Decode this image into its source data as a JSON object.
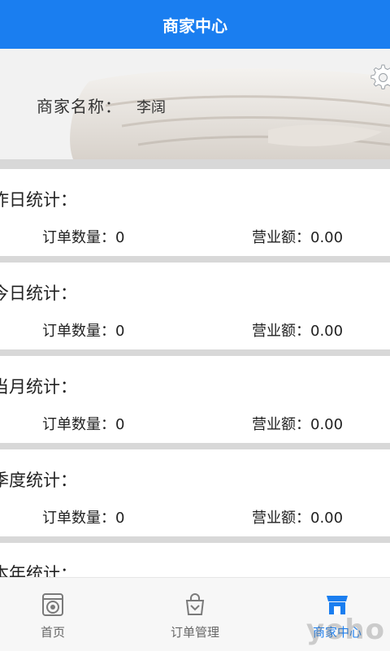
{
  "title": "商家中心",
  "merchant": {
    "label": "商家名称：",
    "name": "李阔"
  },
  "stats": [
    {
      "title": "昨日统计：",
      "orders_label": "订单数量：0",
      "revenue_label": "营业额：0.00"
    },
    {
      "title": "今日统计：",
      "orders_label": "订单数量：0",
      "revenue_label": "营业额：0.00"
    },
    {
      "title": "当月统计：",
      "orders_label": "订单数量：0",
      "revenue_label": "营业额：0.00"
    },
    {
      "title": "季度统计：",
      "orders_label": "订单数量：0",
      "revenue_label": "营业额：0.00"
    },
    {
      "title": "本年统计：",
      "orders_label": "",
      "revenue_label": ""
    }
  ],
  "tabs": [
    {
      "label": "首页",
      "icon": "washing-machine-icon"
    },
    {
      "label": "订单管理",
      "icon": "shopping-bag-icon"
    },
    {
      "label": "商家中心",
      "icon": "storefront-icon"
    }
  ],
  "watermark": "yoho",
  "colors": {
    "primary": "#1a7ef0",
    "separator": "#d8d8d8"
  }
}
